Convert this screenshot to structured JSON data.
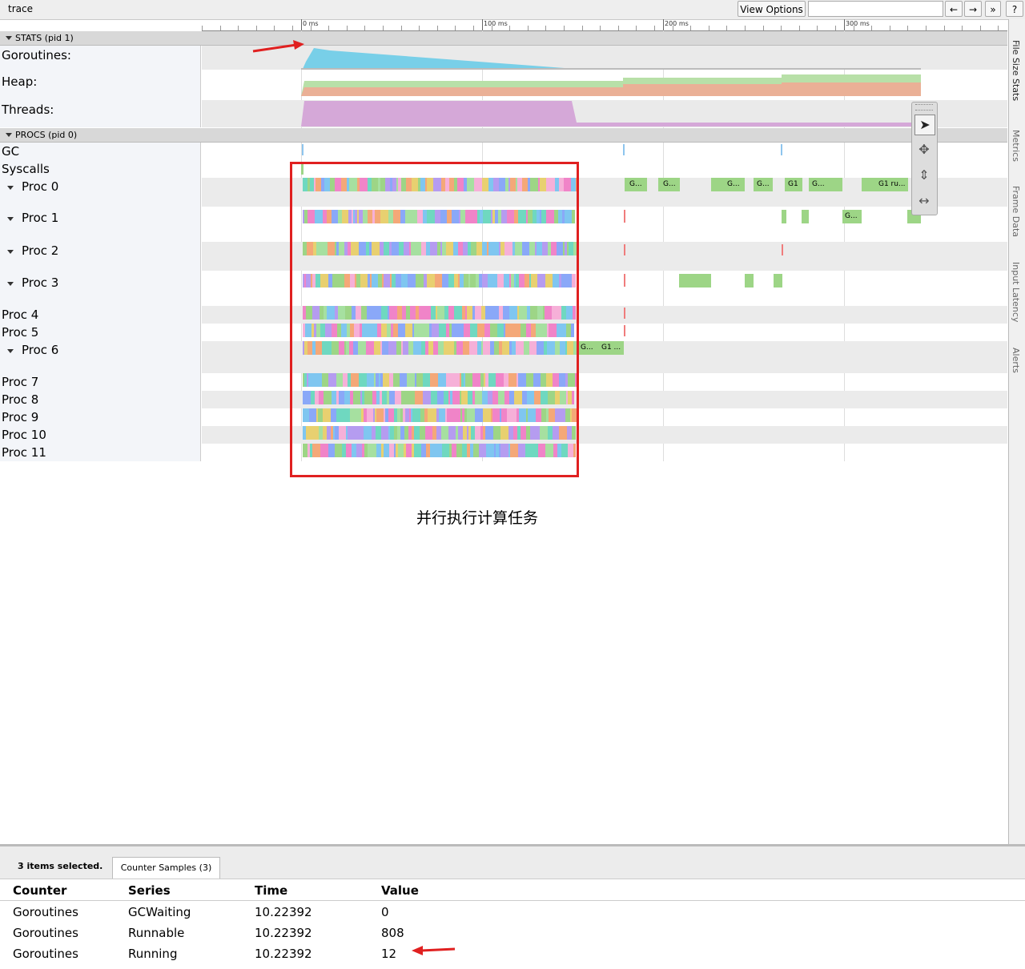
{
  "app": {
    "title": "trace"
  },
  "toolbar": {
    "view_options": "View Options",
    "back": "←",
    "forward": "→",
    "more": "»",
    "help": "?",
    "search_value": ""
  },
  "ruler": {
    "ticks": [
      "0 ms",
      "100 ms",
      "200 ms",
      "300 ms"
    ]
  },
  "stats": {
    "header": "STATS (pid 1)",
    "rows": [
      "Goroutines:",
      "Heap:",
      "Threads:"
    ]
  },
  "procs": {
    "header": "PROCS (pid 0)",
    "gc_label": "GC",
    "syscalls_label": "Syscalls",
    "items": [
      "Proc 0",
      "Proc 1",
      "Proc 2",
      "Proc 3",
      "Proc 4",
      "Proc 5",
      "Proc 6",
      "Proc 7",
      "Proc 8",
      "Proc 9",
      "Proc 10",
      "Proc 11"
    ],
    "slice_labels": [
      "G...",
      "G...",
      "G...",
      "G...",
      "G1",
      "G...",
      "G1 ru...",
      "G...",
      "G...",
      "G1 ..."
    ]
  },
  "side_tabs": [
    "File Size Stats",
    "Metrics",
    "Frame Data",
    "Input Latency",
    "Alerts"
  ],
  "annotation": {
    "caption": "并行执行计算任务"
  },
  "bottom": {
    "selection": "3 items selected.",
    "tab": "Counter Samples (3)",
    "columns": [
      "Counter",
      "Series",
      "Time",
      "Value"
    ],
    "rows": [
      [
        "Goroutines",
        "GCWaiting",
        "10.22392",
        "0"
      ],
      [
        "Goroutines",
        "Runnable",
        "10.22392",
        "808"
      ],
      [
        "Goroutines",
        "Running",
        "10.22392",
        "12"
      ]
    ]
  },
  "colors": {
    "goroutines": "#6ccce8",
    "heap_green": "#b8e0a8",
    "heap_orange": "#eab096",
    "threads": "#d5a8d8",
    "gc_slice": "#9dd586",
    "annotation_red": "#e02020"
  }
}
